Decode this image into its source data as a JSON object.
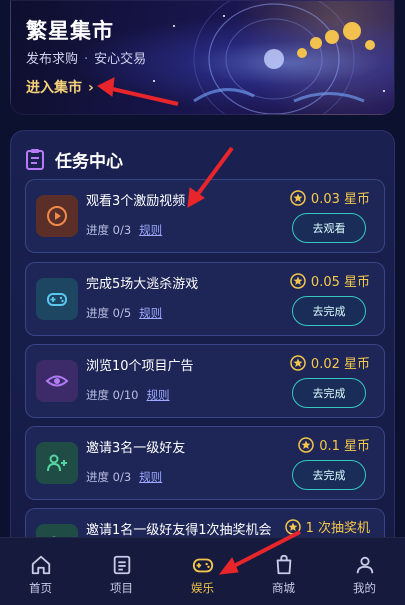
{
  "banner": {
    "title": "繁星集市",
    "subtitle_left": "发布求购",
    "subtitle_sep": "·",
    "subtitle_right": "安心交易",
    "enter_label": "进入集市",
    "enter_chevron": "›"
  },
  "panel": {
    "title": "任务中心",
    "icon": "clipboard-icon"
  },
  "tasks": [
    {
      "name": "观看3个激励视频",
      "progress": "进度 0/3",
      "rule": "规则",
      "reward": "0.03 星币",
      "button": "去观看",
      "icon": "play-circle-icon",
      "icon_bg": "#5b2f28",
      "icon_color": "#f08a4b"
    },
    {
      "name": "完成5场大逃杀游戏",
      "progress": "进度 0/5",
      "rule": "规则",
      "reward": "0.05 星币",
      "button": "去完成",
      "icon": "gamepad-icon",
      "icon_bg": "#1d4662",
      "icon_color": "#5bc6ee"
    },
    {
      "name": "浏览10个项目广告",
      "progress": "进度 0/10",
      "rule": "规则",
      "reward": "0.02 星币",
      "button": "去完成",
      "icon": "eye-icon",
      "icon_bg": "#3d2a68",
      "icon_color": "#b07cf5"
    },
    {
      "name": "邀请3名一级好友",
      "progress": "进度 0/3",
      "rule": "规则",
      "reward": "0.1 星币",
      "button": "去完成",
      "icon": "user-plus-icon",
      "icon_bg": "#1f4c45",
      "icon_color": "#57d3a0"
    },
    {
      "name": "邀请1名一级好友得1次抽奖机会",
      "progress": "",
      "rule": "",
      "reward": "1 次抽奖机",
      "button": "",
      "icon": "user-plus-icon",
      "icon_bg": "#1f4c45",
      "icon_color": "#57d3a0"
    }
  ],
  "nav": [
    {
      "label": "首页",
      "icon": "home-icon",
      "active": false
    },
    {
      "label": "项目",
      "icon": "document-icon",
      "active": false
    },
    {
      "label": "娱乐",
      "icon": "gamepad-icon",
      "active": true
    },
    {
      "label": "商城",
      "icon": "shopping-bag-icon",
      "active": false
    },
    {
      "label": "我的",
      "icon": "user-icon",
      "active": false
    }
  ],
  "colors": {
    "accent_gold": "#f3c64b",
    "button_teal": "#34c8c0",
    "annotation_red": "#e8252b"
  }
}
